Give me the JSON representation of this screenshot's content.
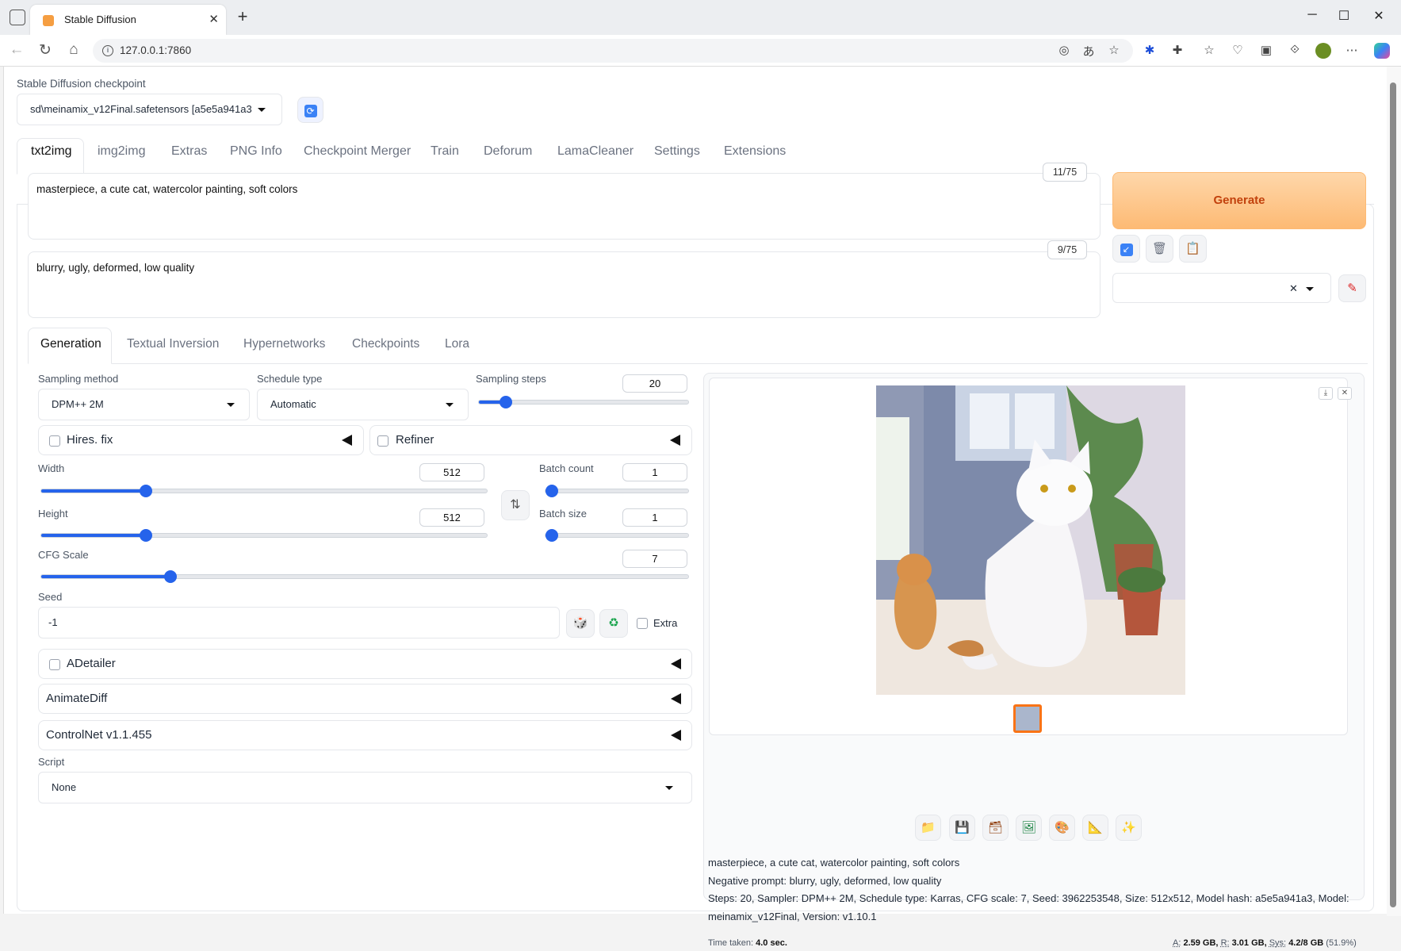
{
  "browser": {
    "tab_title": "Stable Diffusion",
    "url": "127.0.0.1:7860"
  },
  "checkpoint": {
    "label": "Stable Diffusion checkpoint",
    "value": "sd\\meinamix_v12Final.safetensors [a5e5a941a3"
  },
  "main_tabs": [
    "txt2img",
    "img2img",
    "Extras",
    "PNG Info",
    "Checkpoint Merger",
    "Train",
    "Deforum",
    "LamaCleaner",
    "Settings",
    "Extensions"
  ],
  "prompt": {
    "positive": "masterpiece, a cute cat, watercolor painting, soft colors",
    "positive_count": "11/75",
    "negative": "blurry, ugly, deformed, low quality",
    "negative_count": "9/75"
  },
  "generate_label": "Generate",
  "sub_tabs": [
    "Generation",
    "Textual Inversion",
    "Hypernetworks",
    "Checkpoints",
    "Lora"
  ],
  "generation": {
    "sampling_method_label": "Sampling method",
    "sampling_method": "DPM++ 2M",
    "schedule_type_label": "Schedule type",
    "schedule_type": "Automatic",
    "sampling_steps_label": "Sampling steps",
    "sampling_steps": "20",
    "hires_label": "Hires. fix",
    "refiner_label": "Refiner",
    "width_label": "Width",
    "width": "512",
    "height_label": "Height",
    "height": "512",
    "batch_count_label": "Batch count",
    "batch_count": "1",
    "batch_size_label": "Batch size",
    "batch_size": "1",
    "cfg_label": "CFG Scale",
    "cfg": "7",
    "seed_label": "Seed",
    "seed": "-1",
    "extra_label": "Extra",
    "adetailer_label": "ADetailer",
    "animatediff_label": "AnimateDiff",
    "controlnet_label": "ControlNet v1.1.455",
    "script_label": "Script",
    "script": "None"
  },
  "sliders": {
    "sampling_steps_fraction": 0.13,
    "width_fraction": 0.235,
    "height_fraction": 0.235,
    "batch_count_fraction": 0.0,
    "batch_size_fraction": 0.0,
    "cfg_fraction": 0.2
  },
  "output": {
    "line1": "masterpiece, a cute cat, watercolor painting, soft colors",
    "line2": "Negative prompt: blurry, ugly, deformed, low quality",
    "line3": "Steps: 20, Sampler: DPM++ 2M, Schedule type: Karras, CFG scale: 7, Seed: 3962253548, Size: 512x512, Model hash: a5e5a941a3, Model:",
    "line4": "meinamix_v12Final, Version: v1.10.1",
    "time_label": "Time taken:",
    "time_value": "4.0 sec.",
    "a_label": "A:",
    "a_value": "2.59 GB,",
    "r_label": "R:",
    "r_value": "3.01 GB,",
    "sys_label": "Sys:",
    "sys_value": "4.2/8 GB",
    "sys_pct": "(51.9%)"
  },
  "colors": {
    "accent": "#2563eb",
    "generate_bg": "#fdba74",
    "generate_text": "#c2410c"
  }
}
